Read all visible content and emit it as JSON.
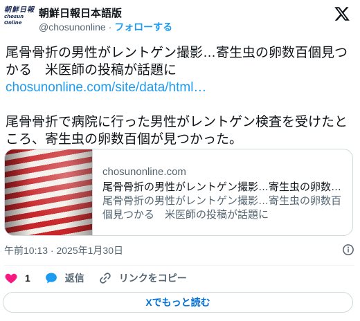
{
  "author": {
    "name": "朝鮮日報日本語版",
    "handle": "@chosunonline",
    "separator": " · ",
    "follow_label": "フォローする",
    "avatar_text_jp": "朝鮮日報",
    "avatar_text_en": "chosun Online"
  },
  "tweet": {
    "paragraph1": "尾骨骨折の男性がレントゲン撮影…寄生虫の卵数百個見つかる　米医師の投稿が話題に",
    "link_text": "chosunonline.com/site/data/html…",
    "paragraph2": "尾骨骨折で病院に行った男性がレントゲン検査を受けたところ、寄生虫の卵数百個が見つかった。"
  },
  "card": {
    "domain": "chosunonline.com",
    "title": "尾骨骨折の男性がレントゲン撮影…寄生虫の卵数百…",
    "description": "尾骨骨折の男性がレントゲン撮影…寄生虫の卵数百個見つかる　米医師の投稿が話題に"
  },
  "meta": {
    "timestamp": "午前10:13 · 2025年1月30日"
  },
  "actions": {
    "like_count": "1",
    "reply_label": "返信",
    "copy_link_label": "リンクをコピー"
  },
  "read_more_label": "Xでもっと読む",
  "colors": {
    "accent": "#1d9bf0",
    "like": "#f91880",
    "text": "#0f1419",
    "muted": "#536471",
    "border": "#cfd9de"
  },
  "icons": [
    "x-logo-icon",
    "info-icon",
    "heart-icon",
    "reply-bubble-icon",
    "link-icon"
  ]
}
